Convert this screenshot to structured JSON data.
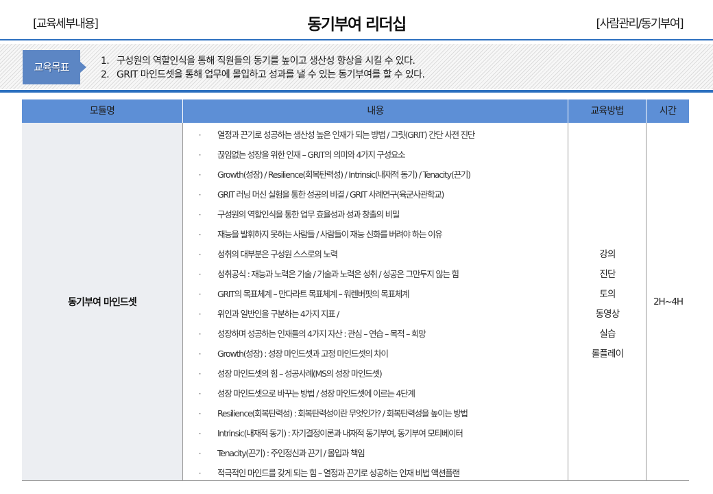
{
  "header": {
    "left_label": "[교육세부내용]",
    "title": "동기부여 리더십",
    "right_label": "[사람관리/동기부여]"
  },
  "goals": {
    "badge_label": "교육목표",
    "items": [
      {
        "num": "1.",
        "text": "구성원의 역할인식을 통해 직원들의 동기를 높이고 생산성 향상을 시킬 수 있다."
      },
      {
        "num": "2.",
        "text": "GRIT 마인드셋을 통해 업무에 몰입하고 성과를 낼 수 있는 동기부여를 할 수 있다."
      }
    ]
  },
  "table": {
    "headers": {
      "module": "모듈명",
      "content": "내용",
      "method": "교육방법",
      "time": "시간"
    },
    "row": {
      "module": "동기부여 마인드셋",
      "bullet": "·",
      "contents": [
        "열정과 끈기로 성공하는 생산성 높은 인재가 되는 방법 / 그릿(GRIT) 간단 사전 진단",
        "끊임없는 성장을 위한 인재 – GRIT의 의미와 4가지 구성요소",
        "Growth(성장) / Resilience(회복탄력성) / Intrinsic(내재적 동기) / Tenacity(끈기)",
        "GRIT 러닝 머신 실험을 통한 성공의 비결 / GRIT 사례연구(육군사관학교)",
        "구성원의 역할인식을 통한 업무 효율성과 성과 창출의 비밀",
        "재능을 발휘하지 못하는 사람들 / 사람들이 재능 신화를 버려야 하는 이유",
        "성취의 대부분은 구성원 스스로의 노력",
        "성취공식 : 재능과 노력은 기술 / 기술과 노력은 성취 / 성공은 그만두지 않는 힘",
        "GRIT의 목표체계 – 만다라트 목표체계 – 워렌버핏의 목표체계",
        "위인과 일반인을 구분하는 4가지 지표 /",
        "성장하며 성공하는 인재들의 4가지 자산 : 관심 – 연습 – 목적 – 희망",
        "Growth(성장) : 성장 마인드셋과 고정 마인드셋의 차이",
        "성장 마인드셋의 힘 – 성공사례(MS의 성장 마인드셋)",
        "성장 마인드셋으로 바꾸는 방법 / 성장 마인드셋에 이르는 4단계",
        "Resilience(회복탄력성) : 회복탄력성이란 무엇인가? / 회복탄력성을 높이는 방법",
        "Intrinsic(내재적 동기) : 자기결정이론과 내재적 동기부여, 동기부여 모티베이터",
        "Tenacity(끈기) : 주인정신과 끈기 / 몰입과 책임",
        "적극적인 마인드를 갖게 되는 힘 – 열정과 끈기로 성공하는 인재 비법 액션플랜"
      ],
      "methods": [
        "강의",
        "진단",
        "토의",
        "동영상",
        "실습",
        "롤플레이"
      ],
      "time": "2H~4H"
    }
  },
  "colors": {
    "accent_blue": "#2b6fbf",
    "header_blue": "#5d8fd6",
    "badge_blue": "#5c86c4",
    "module_cell_bg": "#eceef2"
  }
}
